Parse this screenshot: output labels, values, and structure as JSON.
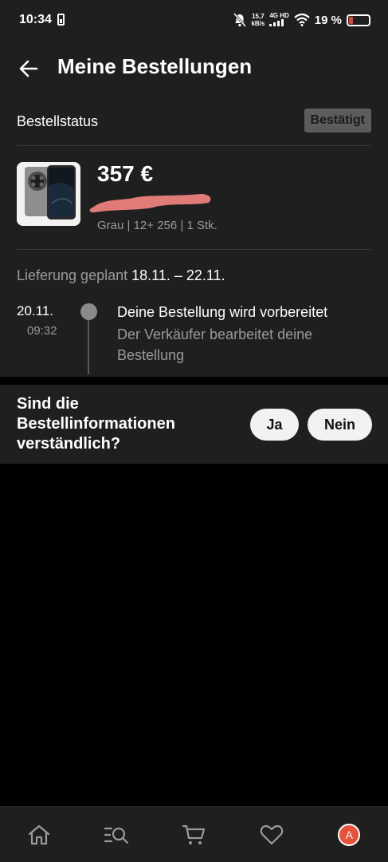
{
  "status_bar": {
    "time": "10:34",
    "speed_value": "15,7",
    "speed_unit": "kB/s",
    "network": "4G HD",
    "battery_percent": "19 %",
    "battery_level": 0.19
  },
  "header": {
    "title": "Meine Bestellungen"
  },
  "order": {
    "status_label": "Bestellstatus",
    "status_badge": "Bestätigt",
    "price": "357 €",
    "variant": "Grau | 12+ 256 | 1 Stk.",
    "delivery_prefix": "Lieferung geplant",
    "delivery_dates": "18.11. – 22.11.",
    "timeline": [
      {
        "date": "20.11.",
        "time": "09:32",
        "title": "Deine Bestellung wird vorbereitet",
        "description": "Der Verkäufer bearbeitet deine Bestellung"
      }
    ]
  },
  "feedback": {
    "question": "Sind die Bestellinformationen verständlich?",
    "yes_label": "Ja",
    "no_label": "Nein"
  },
  "bottom_nav": {
    "items": [
      {
        "icon": "home-icon"
      },
      {
        "icon": "search-list-icon"
      },
      {
        "icon": "cart-icon"
      },
      {
        "icon": "heart-icon"
      },
      {
        "icon": "avatar",
        "initial": "A"
      }
    ]
  },
  "colors": {
    "background": "#000000",
    "surface": "#1f1f1f",
    "badge": "#5c5c5c",
    "accent_avatar": "#e8513a",
    "battery_low": "#e0453a",
    "redaction": "#e07b78"
  }
}
